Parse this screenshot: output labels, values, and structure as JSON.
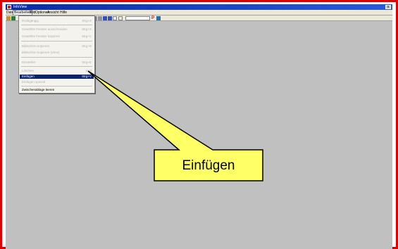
{
  "window": {
    "title": "InfoView",
    "close_label": "x"
  },
  "menubar": [
    {
      "label": "Datei"
    },
    {
      "label": "Bearbeiten"
    },
    {
      "label": "Bild"
    },
    {
      "label": "Optionen"
    },
    {
      "label": "Ansicht"
    },
    {
      "label": "Hilfe"
    }
  ],
  "toolbar": {
    "page_marker": "P"
  },
  "edit_menu": {
    "items": [
      {
        "label": "Rückgängig",
        "shortcut": "Strg+Z",
        "state": "disabled"
      },
      {
        "label": "Gewählte Fenster ausschneiden",
        "shortcut": "Strg+X",
        "state": "disabled"
      },
      {
        "label": "Gewählte Fenster kopieren",
        "shortcut": "Strg+C",
        "state": "disabled"
      },
      {
        "label": "Bildschirm kopieren",
        "shortcut": "Strg+B",
        "state": "disabled"
      },
      {
        "label": "Bildschirm kopieren (ohne)",
        "shortcut": "",
        "state": "disabled"
      },
      {
        "label": "Einstellen",
        "shortcut": "Strg+E",
        "state": "disabled"
      },
      {
        "label": "Löschen",
        "shortcut": "Entf",
        "state": "disabled"
      },
      {
        "label": "Einfügen",
        "shortcut": "Strg+V",
        "state": "selected"
      },
      {
        "label": "Einfügen spezial",
        "shortcut": "",
        "state": "disabled"
      },
      {
        "label": "Zwischenablage leeren",
        "shortcut": "",
        "state": "enabled"
      }
    ]
  },
  "callout": {
    "text": "Einfügen",
    "fill": "#ffff66",
    "border": "#000000"
  }
}
